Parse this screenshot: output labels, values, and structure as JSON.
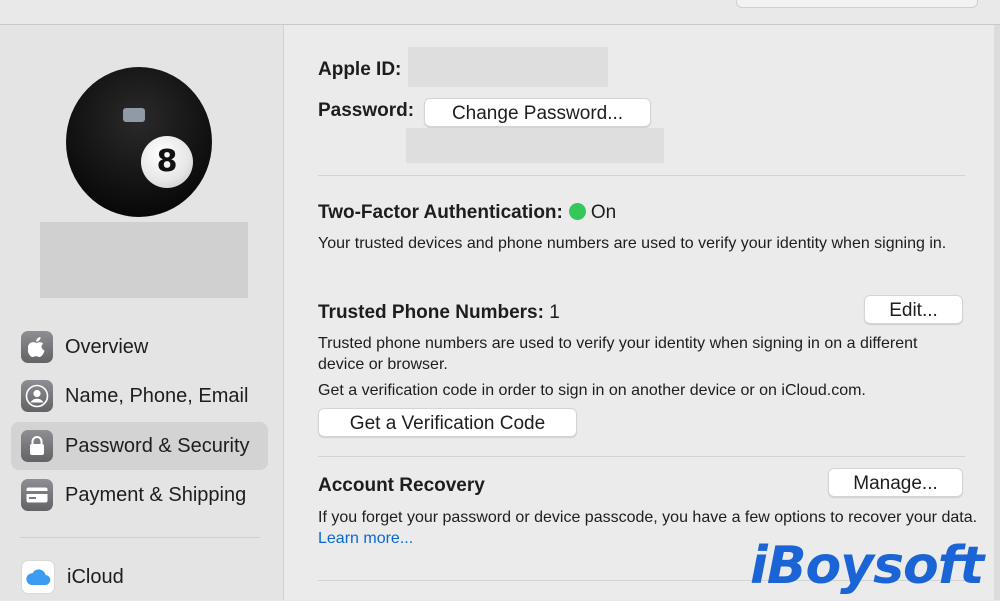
{
  "sidebar": {
    "items": [
      {
        "label": "Overview",
        "icon": "apple-icon"
      },
      {
        "label": "Name, Phone, Email",
        "icon": "person-icon"
      },
      {
        "label": "Password & Security",
        "icon": "lock-icon",
        "selected": true
      },
      {
        "label": "Payment & Shipping",
        "icon": "credit-card-icon"
      },
      {
        "label": "iCloud",
        "icon": "cloud-icon"
      }
    ]
  },
  "account": {
    "apple_id_label": "Apple ID:",
    "password_label": "Password:",
    "change_password_button": "Change Password..."
  },
  "two_factor": {
    "label": "Two-Factor Authentication:",
    "status": "On",
    "status_color": "#34c759",
    "description": "Your trusted devices and phone numbers are used to verify your identity when signing in."
  },
  "trusted_phones": {
    "label": "Trusted Phone Numbers:",
    "count": "1",
    "edit_button": "Edit...",
    "description": "Trusted phone numbers are used to verify your identity when signing in on a different device or browser.",
    "verification_text": "Get a verification code in order to sign in on another device or on iCloud.com.",
    "verification_button": "Get a Verification Code"
  },
  "account_recovery": {
    "label": "Account Recovery",
    "manage_button": "Manage...",
    "description": "If you forget your password or device passcode, you have a few options to recover your data.",
    "learn_more": "Learn more..."
  },
  "watermark": "iBoysoft",
  "colors": {
    "accent_link": "#0b67d0",
    "selection_bg": "#d3d3d3",
    "watermark": "#1b64d6"
  }
}
